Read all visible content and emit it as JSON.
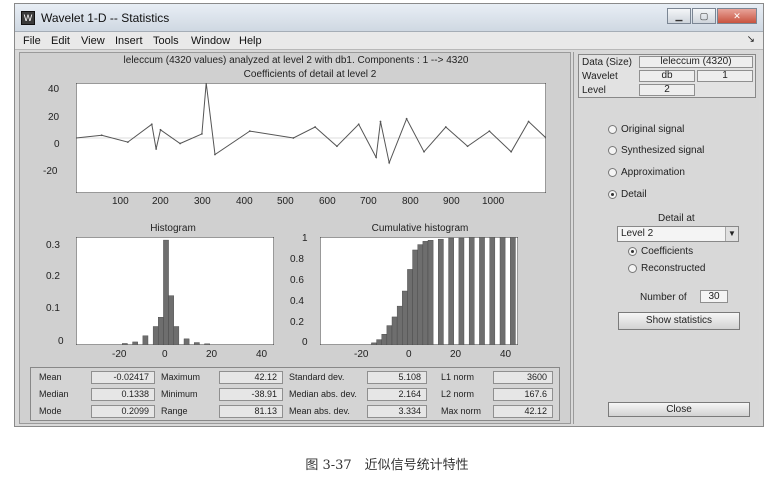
{
  "window": {
    "title": "Wavelet 1-D  --  Statistics",
    "icon": "matlab-icon",
    "controls": [
      "minimize-icon",
      "maximize-icon",
      "close-icon"
    ]
  },
  "menu": {
    "items": [
      "File",
      "Edit",
      "View",
      "Insert",
      "Tools",
      "Window",
      "Help"
    ]
  },
  "main": {
    "info_line": "leleccum (4320 values) analyzed at level 2 with db1.  Components :  1 --> 4320",
    "top_plot": {
      "title": "Coefficients of detail at level 2",
      "y_ticks": [
        "40",
        "20",
        "0",
        "-20"
      ],
      "x_ticks": [
        "100",
        "200",
        "300",
        "400",
        "500",
        "600",
        "700",
        "800",
        "900",
        "1000"
      ]
    },
    "histogram": {
      "title": "Histogram",
      "y_ticks": [
        "0.3",
        "0.2",
        "0.1",
        "0"
      ],
      "x_ticks": [
        "-20",
        "0",
        "20",
        "40"
      ]
    },
    "cumulative": {
      "title": "Cumulative histogram",
      "y_ticks": [
        "1",
        "0.8",
        "0.6",
        "0.4",
        "0.2",
        "0"
      ],
      "x_ticks": [
        "-20",
        "0",
        "20",
        "40"
      ]
    }
  },
  "chart_data": [
    {
      "type": "line",
      "title": "Coefficients of detail at level 2",
      "xlim": [
        1,
        1080
      ],
      "ylim": [
        -40,
        40
      ],
      "x": [
        1,
        60,
        120,
        175,
        185,
        195,
        240,
        290,
        300,
        320,
        400,
        500,
        550,
        600,
        650,
        690,
        700,
        720,
        760,
        800,
        850,
        900,
        950,
        1000,
        1040,
        1080
      ],
      "y": [
        0,
        2,
        -3,
        10,
        -8,
        6,
        -4,
        3,
        40,
        -12,
        5,
        0,
        8,
        -6,
        10,
        -14,
        12,
        -18,
        14,
        -10,
        8,
        -6,
        5,
        -10,
        12,
        0
      ]
    },
    {
      "type": "bar",
      "title": "Histogram",
      "xlim": [
        -35,
        42
      ],
      "ylim": [
        0,
        0.35
      ],
      "x": [
        -16,
        -12,
        -8,
        -4,
        -2,
        0,
        2,
        4,
        8,
        12,
        16
      ],
      "values": [
        0.005,
        0.01,
        0.03,
        0.06,
        0.09,
        0.34,
        0.16,
        0.06,
        0.02,
        0.008,
        0.004
      ]
    },
    {
      "type": "bar",
      "title": "Cumulative histogram",
      "xlim": [
        -35,
        42
      ],
      "ylim": [
        0,
        1
      ],
      "x": [
        -14,
        -12,
        -10,
        -8,
        -6,
        -4,
        -2,
        0,
        2,
        4,
        6,
        8,
        12,
        16,
        20,
        24,
        28,
        32,
        36,
        40
      ],
      "values": [
        0.02,
        0.05,
        0.1,
        0.18,
        0.26,
        0.36,
        0.5,
        0.7,
        0.88,
        0.93,
        0.96,
        0.97,
        0.98,
        0.99,
        0.99,
        1.0,
        1.0,
        1.0,
        1.0,
        1.0
      ]
    }
  ],
  "stats": [
    {
      "label": "Mean",
      "value": "-0.02417"
    },
    {
      "label": "Median",
      "value": "0.1338"
    },
    {
      "label": "Mode",
      "value": "0.2099"
    },
    {
      "label": "Maximum",
      "value": "42.12"
    },
    {
      "label": "Minimum",
      "value": "-38.91"
    },
    {
      "label": "Range",
      "value": "81.13"
    },
    {
      "label": "Standard dev.",
      "value": "5.108"
    },
    {
      "label": "Median abs. dev.",
      "value": "2.164"
    },
    {
      "label": "Mean abs. dev.",
      "value": "3.334"
    },
    {
      "label": "L1 norm",
      "value": "3600"
    },
    {
      "label": "L2 norm",
      "value": "167.6"
    },
    {
      "label": "Max norm",
      "value": "42.12"
    }
  ],
  "side": {
    "data_label": "Data  (Size)",
    "data_value": "leleccum  (4320)",
    "wavelet_label": "Wavelet",
    "wavelet_name": "db",
    "wavelet_order": "1",
    "level_label": "Level",
    "level_value": "2",
    "radios": [
      {
        "label": "Original signal",
        "selected": false
      },
      {
        "label": "Synthesized signal",
        "selected": false
      },
      {
        "label": "Approximation",
        "selected": false
      },
      {
        "label": "Detail",
        "selected": true
      }
    ],
    "detail_at_label": "Detail at",
    "detail_level": "Level  2",
    "sub_radios": [
      {
        "label": "Coefficients",
        "selected": true
      },
      {
        "label": "Reconstructed",
        "selected": false
      }
    ],
    "number_of_label": "Number of",
    "number_of_value": "30",
    "show_stats": "Show statistics",
    "close": "Close"
  },
  "caption": "图 3-37　近似信号统计特性"
}
